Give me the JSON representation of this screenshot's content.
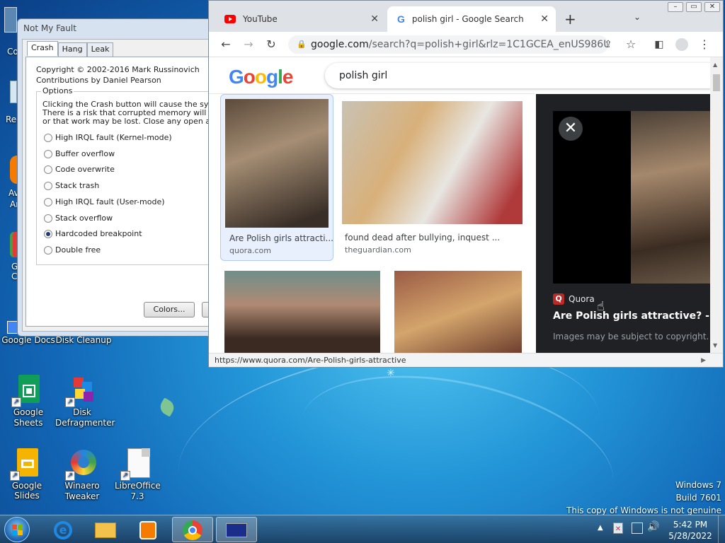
{
  "desktop": {
    "icons": [
      {
        "label": "Google Docs"
      },
      {
        "label": "Disk Cleanup"
      },
      {
        "label": "Google Sheets"
      },
      {
        "label": "Disk Defragmenter"
      },
      {
        "label": "Google Slides"
      },
      {
        "label": "Winaero Tweaker"
      },
      {
        "label": "LibreOffice 7.3"
      }
    ],
    "partial_labels": [
      "Co",
      "Rec",
      "Av",
      "Ar",
      "G",
      "C"
    ]
  },
  "nmf": {
    "title": "Not My Fault",
    "tabs": [
      "Crash",
      "Hang",
      "Leak"
    ],
    "copyright": "Copyright © 2002-2016 Mark Russinovich",
    "contrib": "Contributions by Daniel Pearson",
    "options_label": "Options",
    "options_text": [
      "Clicking the Crash button will cause the system to",
      "There is a risk that corrupted memory will be writt",
      "or that work may be lost. Close any open applicat"
    ],
    "radios": [
      {
        "label": "High IRQL fault (Kernel-mode)",
        "selected": false
      },
      {
        "label": "Buffer overflow",
        "selected": false
      },
      {
        "label": "Code overwrite",
        "selected": false
      },
      {
        "label": "Stack trash",
        "selected": false
      },
      {
        "label": "High IRQL fault (User-mode)",
        "selected": false
      },
      {
        "label": "Stack overflow",
        "selected": false
      },
      {
        "label": "Hardcoded breakpoint",
        "selected": true
      },
      {
        "label": "Double free",
        "selected": false
      }
    ],
    "colors_button": "Colors..."
  },
  "chrome": {
    "tabs": [
      {
        "title": "YouTube",
        "icon": "youtube-icon"
      },
      {
        "title": "polish girl - Google Search",
        "icon": "google-icon"
      }
    ],
    "new_tab": "+",
    "url_host": "google.com",
    "url_rest": "/search?q=polish+girl&rlz=1C1GCEA_enUS986US9...",
    "logo": "Google",
    "logo_colors": [
      "#4285F4",
      "#EA4335",
      "#FBBC05",
      "#4285F4",
      "#34A853",
      "#EA4335"
    ],
    "query": "polish girl",
    "results": [
      {
        "title": "Are Polish girls attracti...",
        "source": "quora.com"
      },
      {
        "title": "found dead after bullying, inquest ...",
        "source": "theguardian.com"
      }
    ],
    "panel": {
      "source": "Quora",
      "title": "Are Polish girls attractive? - Quo",
      "note": "Images may be subject to copyright. Le"
    },
    "status_url": "https://www.quora.com/Are-Polish-girls-attractive"
  },
  "watermark": {
    "line1": "Windows 7",
    "line2": "Build 7601",
    "line3": "This copy of Windows is not genuine"
  },
  "clock": {
    "time": "5:42 PM",
    "date": "5/28/2022"
  }
}
